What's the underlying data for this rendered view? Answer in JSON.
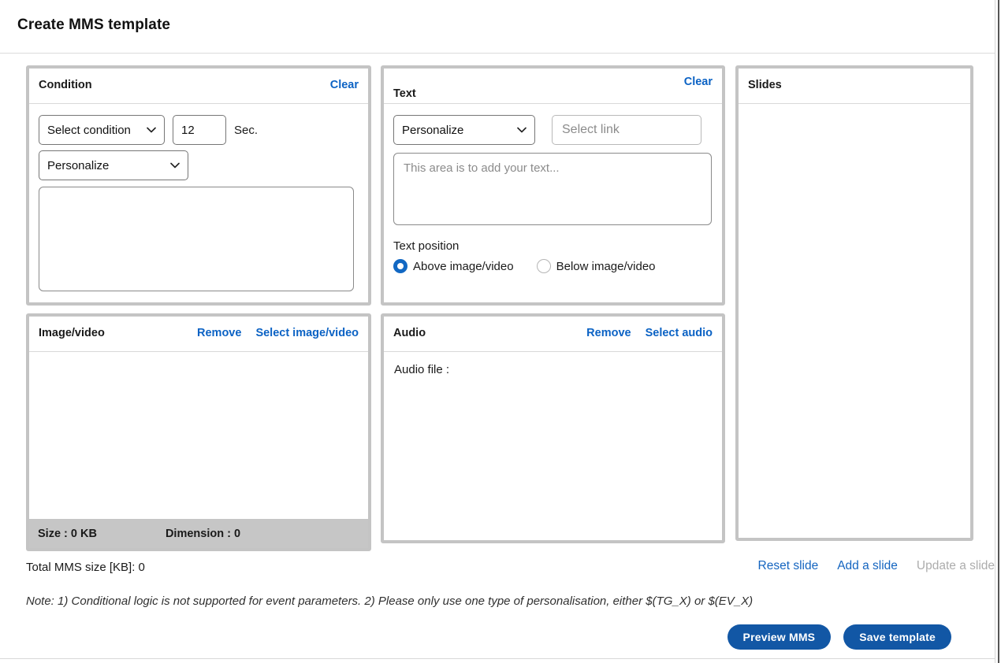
{
  "header": {
    "title": "Create MMS template"
  },
  "condition_panel": {
    "title": "Condition",
    "clear_label": "Clear",
    "condition_select": {
      "value": "Select condition",
      "options": [
        "Select condition"
      ]
    },
    "seconds_value": "12",
    "seconds_unit": "Sec.",
    "personalize_select": {
      "value": "Personalize",
      "options": [
        "Personalize"
      ]
    },
    "expression_placeholder": "",
    "expression_value": ""
  },
  "text_panel": {
    "title": "Text",
    "clear_label": "Clear",
    "personalize_select": {
      "value": "Personalize",
      "options": [
        "Personalize"
      ]
    },
    "link_input": {
      "value": "",
      "placeholder": "Select link"
    },
    "textarea": {
      "value": "",
      "placeholder": "This area is to add your text..."
    },
    "position_label": "Text position",
    "position_options": [
      {
        "label": "Above image/video",
        "selected": true
      },
      {
        "label": "Below image/video",
        "selected": false
      }
    ]
  },
  "image_panel": {
    "title": "Image/video",
    "remove_label": "Remove",
    "select_label": "Select image/video",
    "size_label": "Size : 0 KB",
    "dimension_label": "Dimension : 0"
  },
  "audio_panel": {
    "title": "Audio",
    "remove_label": "Remove",
    "select_label": "Select audio",
    "audio_file_label": "Audio file :"
  },
  "slides_panel": {
    "title": "Slides"
  },
  "slide_actions": [
    {
      "label": "Reset slide",
      "disabled": false
    },
    {
      "label": "Add a slide",
      "disabled": false
    },
    {
      "label": "Update a slide",
      "disabled": true
    }
  ],
  "total_size": "Total MMS size [KB]: 0",
  "note": "Note: 1) Conditional logic is not supported for event parameters. 2) Please only use one type of personalisation, either $(TG_X) or $(EV_X)",
  "footer": {
    "preview_label": "Preview MMS",
    "save_label": "Save template"
  },
  "colors": {
    "link_blue": "#0b62c4",
    "action_blue": "#1565c0",
    "button_blue": "#1257a5",
    "radio_blue": "#1268c3",
    "panel_border": "#c4c4c4",
    "media_footer_gray": "#c6c6c6",
    "disabled_gray": "#adadad"
  }
}
